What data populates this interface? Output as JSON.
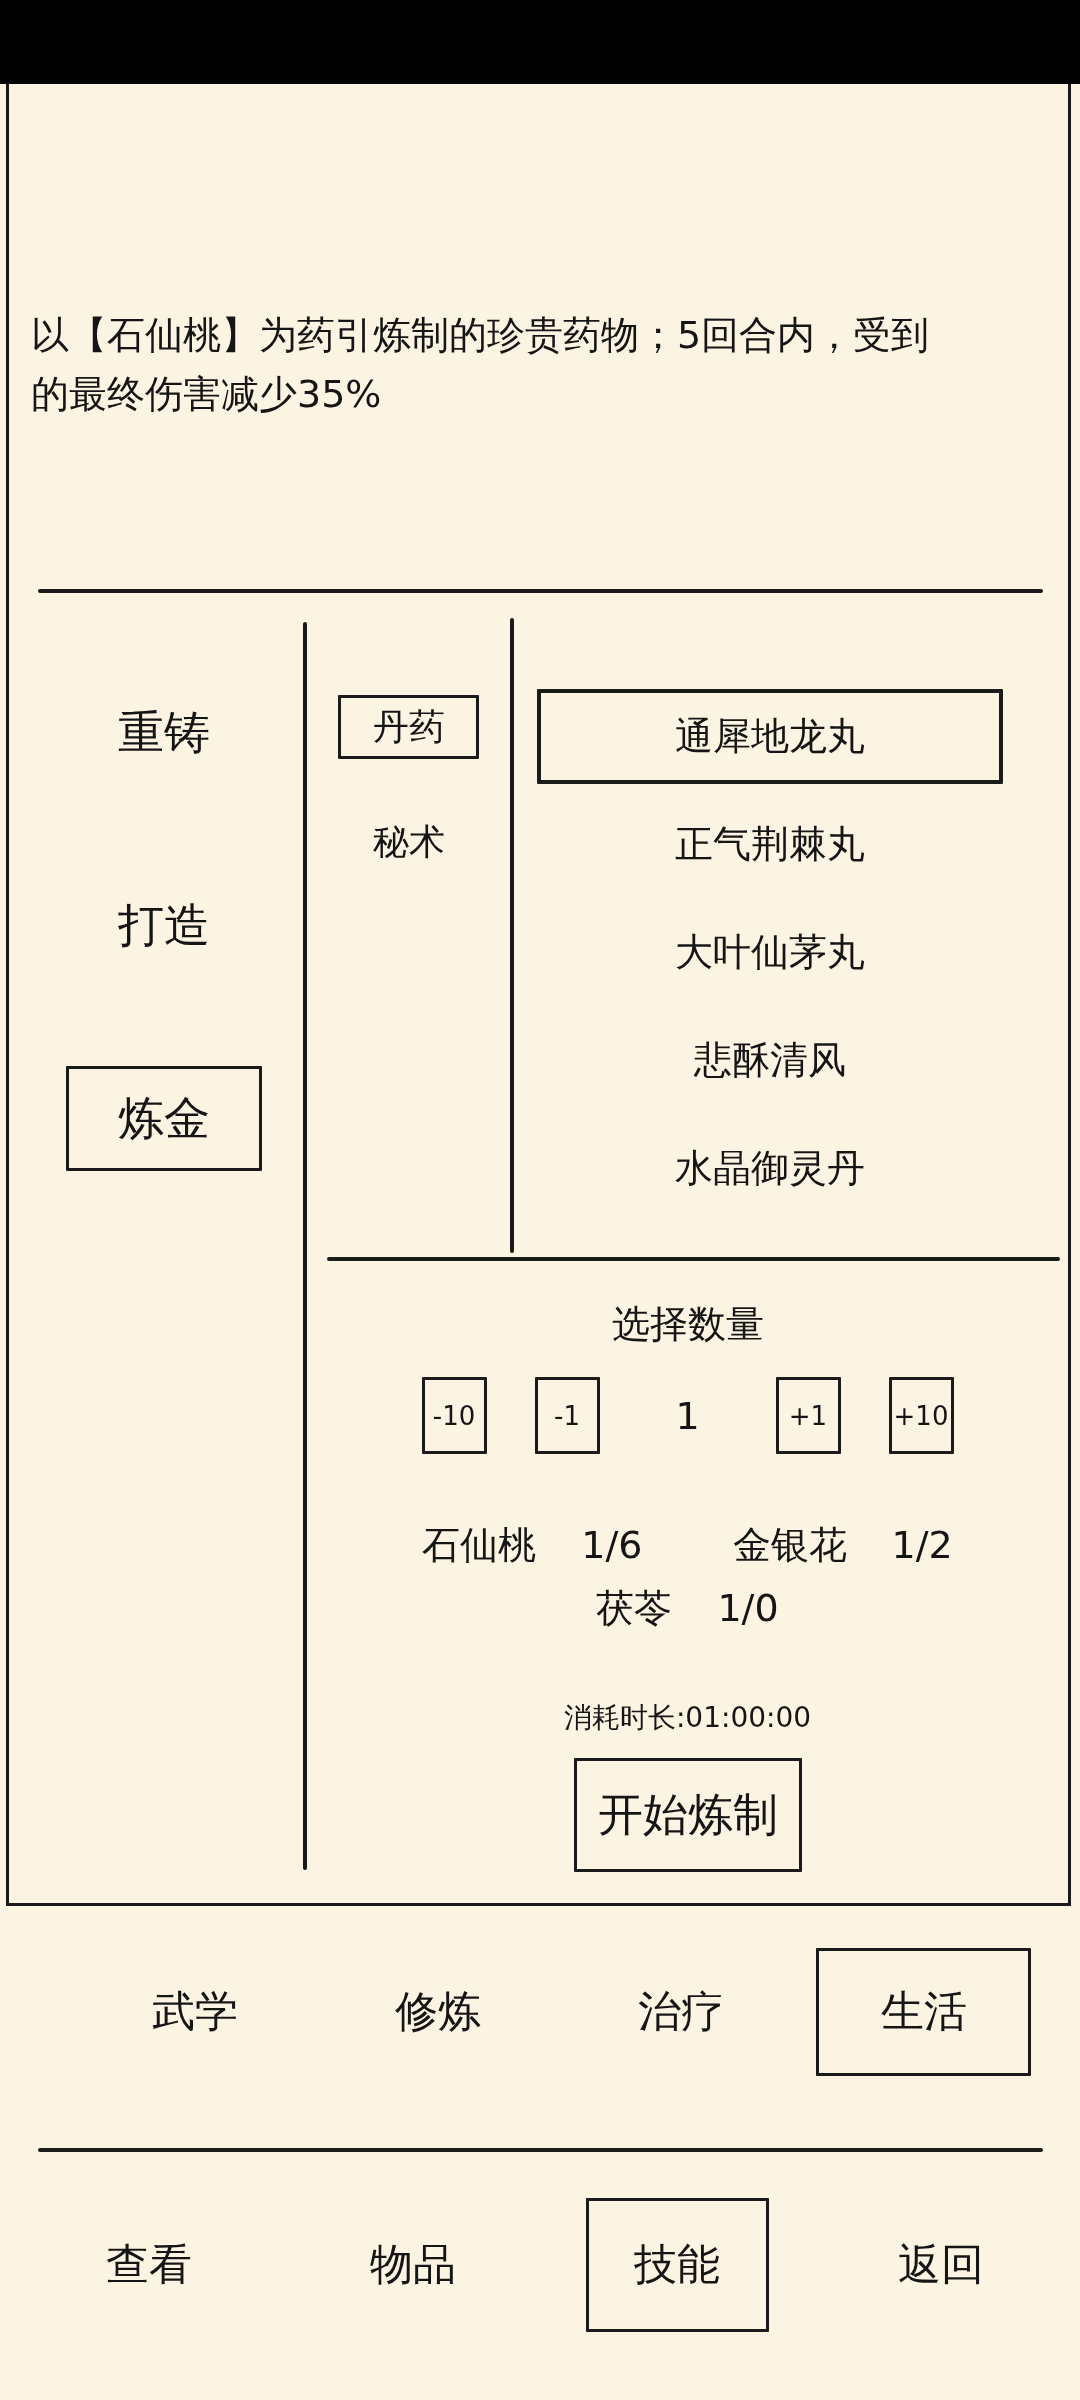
{
  "description": "以【石仙桃】为药引炼制的珍贵药物；5回合内，受到的最终伤害减少35%",
  "crafts": [
    {
      "label": "重铸",
      "selected": false
    },
    {
      "label": "打造",
      "selected": false
    },
    {
      "label": "炼金",
      "selected": true
    }
  ],
  "categories": [
    {
      "label": "丹药",
      "selected": true
    },
    {
      "label": "秘术",
      "selected": false
    }
  ],
  "recipes": [
    {
      "label": "通犀地龙丸",
      "selected": true
    },
    {
      "label": "正气荆棘丸",
      "selected": false
    },
    {
      "label": "大叶仙茅丸",
      "selected": false
    },
    {
      "label": "悲酥清风",
      "selected": false
    },
    {
      "label": "水晶御灵丹",
      "selected": false
    }
  ],
  "quantity": {
    "title": "选择数量",
    "controls": [
      {
        "kind": "button",
        "label": "-10"
      },
      {
        "kind": "button",
        "label": "-1"
      },
      {
        "kind": "value",
        "label": "1"
      },
      {
        "kind": "button",
        "label": "+1"
      },
      {
        "kind": "button",
        "label": "+10"
      }
    ]
  },
  "materials": [
    {
      "name": "石仙桃",
      "count": "1/6"
    },
    {
      "name": "金银花",
      "count": "1/2"
    },
    {
      "name": "茯苓",
      "count": "1/0"
    }
  ],
  "duration": "消耗时长:01:00:00",
  "start_button": "开始炼制",
  "skill_tabs": [
    {
      "label": "武学",
      "selected": false
    },
    {
      "label": "修炼",
      "selected": false
    },
    {
      "label": "治疗",
      "selected": false
    },
    {
      "label": "生活",
      "selected": true
    }
  ],
  "nav": [
    {
      "label": "查看",
      "selected": false
    },
    {
      "label": "物品",
      "selected": false
    },
    {
      "label": "技能",
      "selected": true
    },
    {
      "label": "返回",
      "selected": false
    }
  ]
}
